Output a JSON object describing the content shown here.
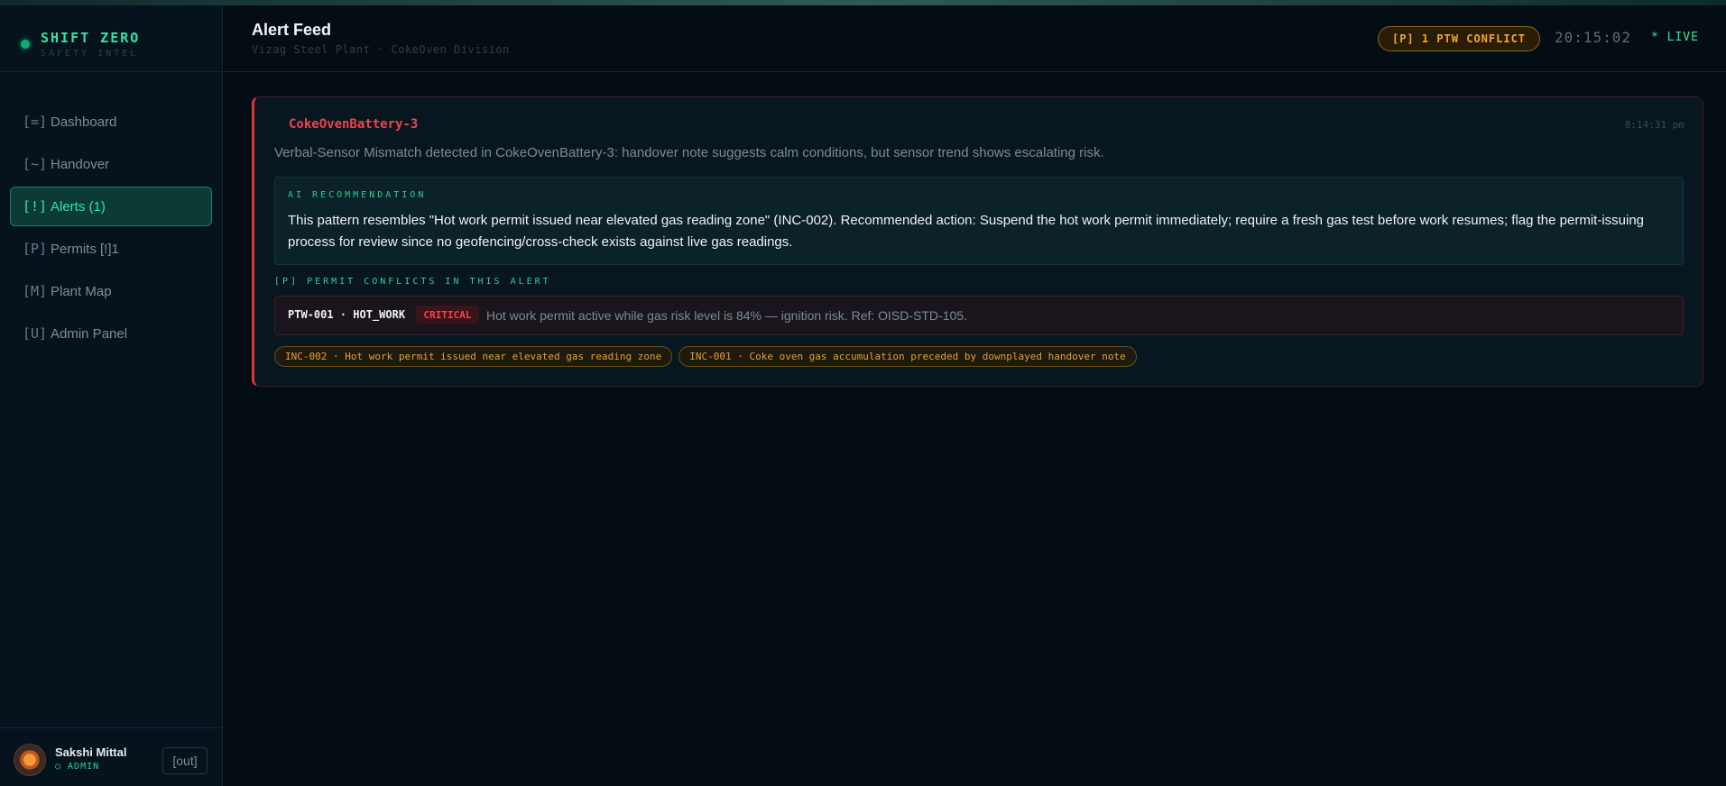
{
  "brand": {
    "title": "SHIFT ZERO",
    "subtitle": "SAFETY INTEL"
  },
  "nav": [
    {
      "icon": "[=]",
      "label": "Dashboard",
      "active": false
    },
    {
      "icon": "[~]",
      "label": "Handover",
      "active": false
    },
    {
      "icon": "[!]",
      "label": "Alerts (1)",
      "active": true
    },
    {
      "icon": "[P]",
      "label": "Permits [!]1",
      "active": false
    },
    {
      "icon": "[M]",
      "label": "Plant Map",
      "active": false
    },
    {
      "icon": "[U]",
      "label": "Admin Panel",
      "active": false
    }
  ],
  "user": {
    "name": "Sakshi Mittal",
    "role": "○ ADMIN",
    "logout": "[out]"
  },
  "header": {
    "title": "Alert Feed",
    "subtitle": "Vizag Steel Plant · CokeOven Division",
    "ptw_badge": "[P] 1 PTW CONFLICT",
    "clock": "20:15:02",
    "live": "* LIVE"
  },
  "alert": {
    "location": "CokeOvenBattery-3",
    "time": "8:14:31 pm",
    "description": "Verbal-Sensor Mismatch detected in CokeOvenBattery-3: handover note suggests calm conditions, but sensor trend shows escalating risk.",
    "ai_label": "AI RECOMMENDATION",
    "ai_text": "This pattern resembles \"Hot work permit issued near elevated gas reading zone\" (INC-002). Recommended action: Suspend the hot work permit immediately; require a fresh gas test before work resumes; flag the permit-issuing process for review since no geofencing/cross-check exists against live gas readings.",
    "permit_label": "[P] PERMIT CONFLICTS IN THIS ALERT",
    "permit": {
      "id": "PTW-001 · HOT_WORK",
      "severity": "CRITICAL",
      "note": "Hot work permit active while gas risk level is 84% — ignition risk. Ref: OISD-STD-105."
    },
    "tags": [
      "INC-002 · Hot work permit issued near elevated gas reading zone",
      "INC-001 · Coke oven gas accumulation preceded by downplayed handover note"
    ]
  },
  "colors": {
    "accent": "#2ee6a6",
    "critical": "#f0454b",
    "warning": "#f2a72a",
    "background": "#050d14"
  }
}
